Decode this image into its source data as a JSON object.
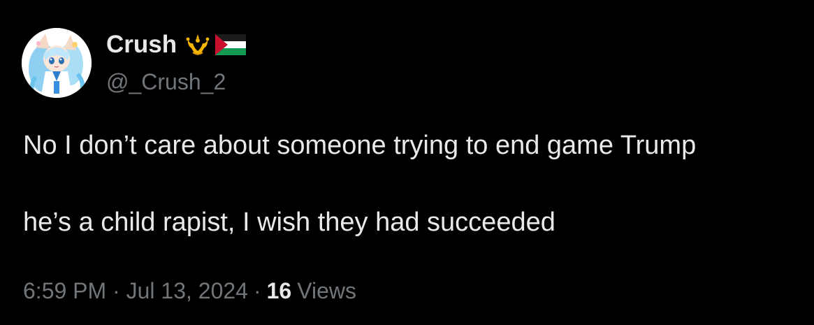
{
  "author": {
    "display_name": "Crush",
    "handle": "@_Crush_2",
    "avatar_icon": "anime-character-avatar",
    "badges": [
      "crown-trident-emoji",
      "palestine-flag-emoji"
    ]
  },
  "tweet": {
    "paragraphs": [
      "No I don’t care about someone trying to end game Trump",
      "he’s a child rapist, I wish they had succeeded"
    ]
  },
  "meta": {
    "timestamp": "6:59 PM · Jul 13, 2024",
    "separator": "·",
    "views_count": "16",
    "views_label": "Views"
  },
  "colors": {
    "background": "#000000",
    "primary_text": "#e7e9ea",
    "secondary_text": "#71767b",
    "crown_gold": "#f4b400",
    "flag_red": "#c8102e",
    "flag_green": "#149954"
  }
}
